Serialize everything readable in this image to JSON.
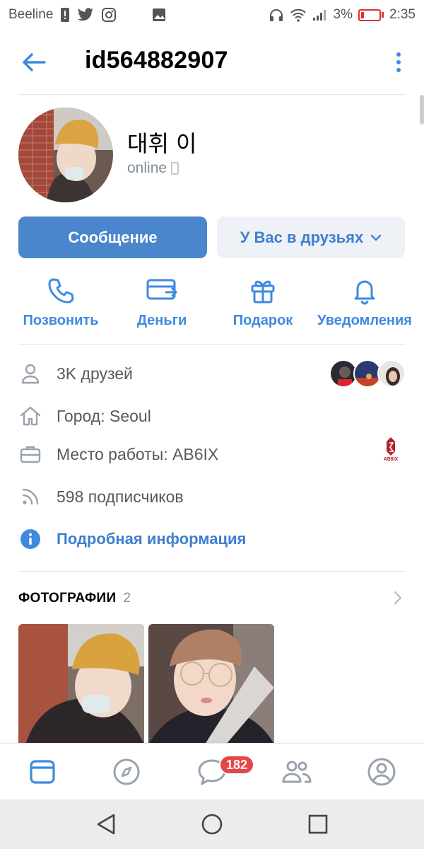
{
  "status_bar": {
    "carrier": "Beeline",
    "battery_percent": "3%",
    "time": "2:35"
  },
  "header": {
    "title": "id564882907"
  },
  "profile": {
    "name": "대휘 이",
    "status": "online"
  },
  "buttons": {
    "message": "Сообщение",
    "friends": "У Вас в друзьях"
  },
  "actions": [
    {
      "label": "Позвонить",
      "icon": "phone-icon"
    },
    {
      "label": "Деньги",
      "icon": "money-icon"
    },
    {
      "label": "Подарок",
      "icon": "gift-icon"
    },
    {
      "label": "Уведомления",
      "icon": "bell-icon"
    }
  ],
  "info": {
    "friends": "3K друзей",
    "city": "Город: Seoul",
    "work": "Место работы: AB6IX",
    "work_logo_text": "AB6IX",
    "followers": "598 подписчиков",
    "details_link": "Подробная информация"
  },
  "photos": {
    "title": "ФОТОГРАФИИ",
    "count": "2"
  },
  "tabbar": {
    "messages_badge": "182"
  },
  "colors": {
    "accent": "#3f8ae0",
    "primary_button": "#4986cc",
    "secondary_button": "#eef1f5",
    "badge": "#e64646",
    "muted_text": "#818c99"
  }
}
